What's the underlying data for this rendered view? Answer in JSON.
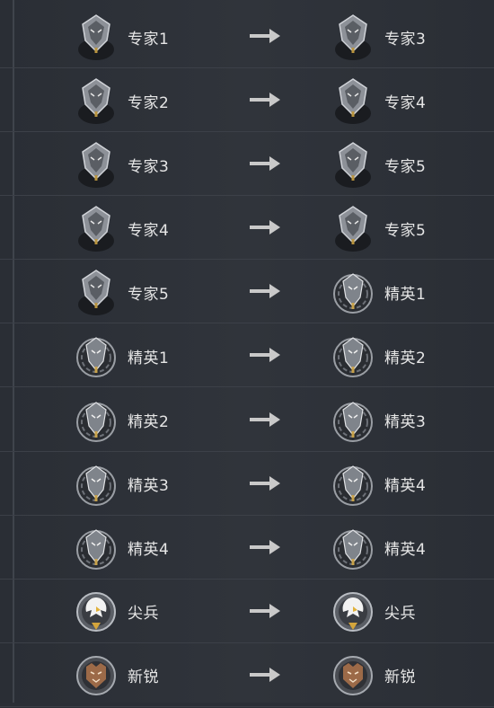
{
  "rows": [
    {
      "from": {
        "label": "专家1",
        "badge": "wolf-expert-badge"
      },
      "to": {
        "label": "专家3",
        "badge": "wolf-expert-badge"
      }
    },
    {
      "from": {
        "label": "专家2",
        "badge": "wolf-expert-badge"
      },
      "to": {
        "label": "专家4",
        "badge": "wolf-expert-badge"
      }
    },
    {
      "from": {
        "label": "专家3",
        "badge": "wolf-expert-badge"
      },
      "to": {
        "label": "专家5",
        "badge": "wolf-expert-badge"
      }
    },
    {
      "from": {
        "label": "专家4",
        "badge": "wolf-expert-badge"
      },
      "to": {
        "label": "专家5",
        "badge": "wolf-expert-badge"
      }
    },
    {
      "from": {
        "label": "专家5",
        "badge": "wolf-expert-badge"
      },
      "to": {
        "label": "精英1",
        "badge": "wolf-elite-badge"
      }
    },
    {
      "from": {
        "label": "精英1",
        "badge": "wolf-elite-badge"
      },
      "to": {
        "label": "精英2",
        "badge": "wolf-elite-badge"
      }
    },
    {
      "from": {
        "label": "精英2",
        "badge": "wolf-elite-badge"
      },
      "to": {
        "label": "精英3",
        "badge": "wolf-elite-badge"
      }
    },
    {
      "from": {
        "label": "精英3",
        "badge": "wolf-elite-badge"
      },
      "to": {
        "label": "精英4",
        "badge": "wolf-elite-badge"
      }
    },
    {
      "from": {
        "label": "精英4",
        "badge": "wolf-elite-badge"
      },
      "to": {
        "label": "精英4",
        "badge": "wolf-elite-badge"
      }
    },
    {
      "from": {
        "label": "尖兵",
        "badge": "eagle-badge"
      },
      "to": {
        "label": "尖兵",
        "badge": "eagle-badge"
      }
    },
    {
      "from": {
        "label": "新锐",
        "badge": "tiger-badge"
      },
      "to": {
        "label": "新锐",
        "badge": "tiger-badge"
      }
    }
  ],
  "arrow_icon": "arrow-right-icon",
  "colors": {
    "background": "#2b2f36",
    "divider": "#3c4048",
    "arrow": "#c9c9c9",
    "label": "#e6e6e6"
  }
}
